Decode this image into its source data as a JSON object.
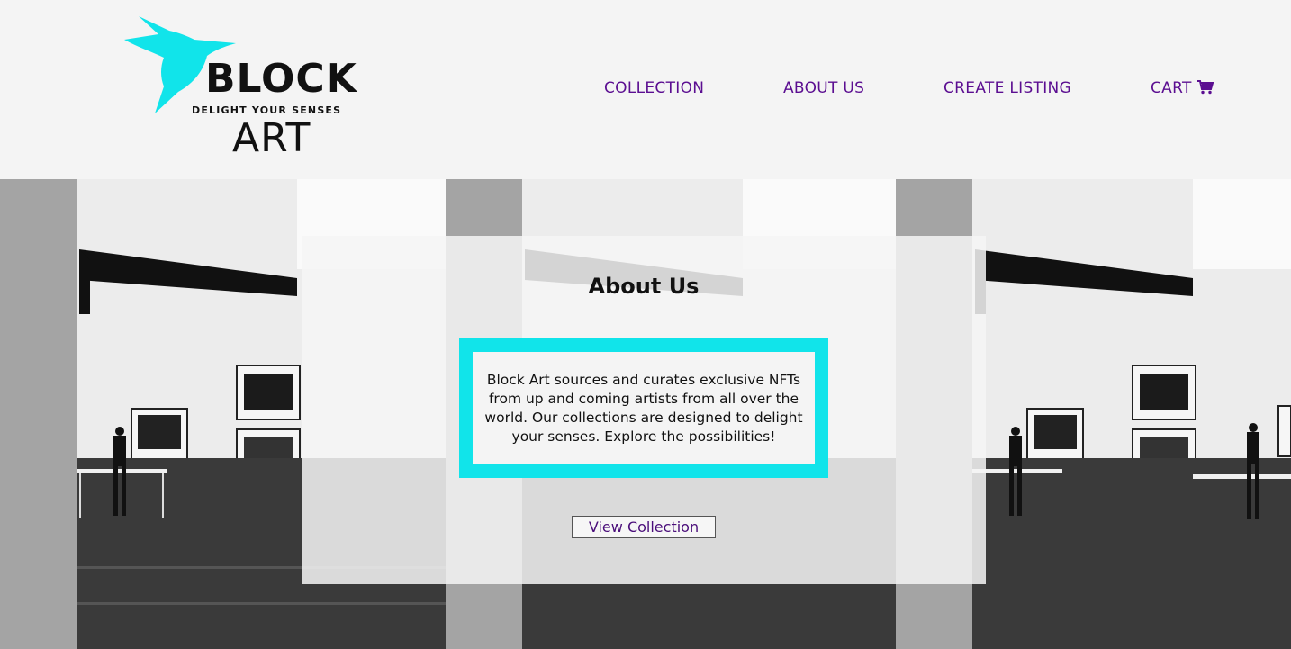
{
  "brand": {
    "name_top": "BLOCK",
    "tagline": "DELIGHT YOUR SENSES",
    "name_bottom": "ART",
    "bird_color": "#11e4ea"
  },
  "nav": {
    "items": [
      {
        "label": "COLLECTION"
      },
      {
        "label": "ABOUT US"
      },
      {
        "label": "CREATE LISTING"
      },
      {
        "label": "CART"
      }
    ],
    "color": "#5b0e91",
    "cart_icon": "shopping-cart-icon"
  },
  "about": {
    "title": "About Us",
    "body": "Block Art sources and curates exclusive NFTs from up and coming artists from all over the world. Our collections are designed to delight your senses. Explore the possibilities!",
    "button_label": "View Collection",
    "accent": "#11e4ea"
  }
}
